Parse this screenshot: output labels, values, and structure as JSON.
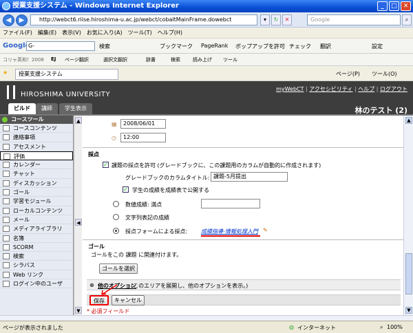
{
  "window": {
    "title": "授業支援システム - Windows Internet Explorer"
  },
  "address": {
    "url": "http://webct6.riise.hiroshima-u.ac.jp/webct/cobaltMainFrame.dowebct",
    "search_placeholder": "Google"
  },
  "menubar": [
    "ファイル(F)",
    "編集(E)",
    "表示(V)",
    "お気に入り(A)",
    "ツール(T)",
    "ヘルプ(H)"
  ],
  "google_toolbar": {
    "logo": "Google",
    "search": "G-",
    "items": [
      "検索",
      "ブックマーク",
      "PageRank",
      "ポップアップを許可",
      "チェック",
      "翻訳",
      "設定"
    ]
  },
  "dict_toolbar": {
    "items": [
      "コリャ英和！2008",
      "EJ",
      "ページ翻訳",
      "選択文翻訳",
      "辞書",
      "検索",
      "読み上げ",
      "ツール"
    ]
  },
  "ie_tab": {
    "label": "授業支援システム",
    "right_items": [
      "ページ(P)",
      "ツール(O)"
    ]
  },
  "header": {
    "university": "HIROSHIMA UNIVERSITY",
    "links": [
      "myWebCT",
      "アクセシビリティ",
      "ヘルプ",
      "ログアウト"
    ],
    "user": "林のテスト (2)",
    "tabs": {
      "build": "ビルド",
      "teacher": "講師",
      "student": "学生表示"
    }
  },
  "sidebar": {
    "heading": "コースツール",
    "items": [
      "コースコンテンツ",
      "連絡事項",
      "アセスメント",
      "評価",
      "カレンダー",
      "チャット",
      "ディスカッション",
      "ゴール",
      "学習モジュール",
      "ローカルコンテンツ",
      "メール",
      "メディアライブラリ",
      "名簿",
      "SCORM",
      "検索",
      "シラバス",
      "Web リンク",
      "ログイン中のユーザ"
    ]
  },
  "form": {
    "date_value": "2008/06/01",
    "time_value": "12:00",
    "grading_heading": "採点",
    "allow_grading_label": "課題の採点を許可 (グレードブックに、この課題用のカラムが自動的に作成されます)",
    "column_title_label": "グレードブックのカラムタイトル:",
    "column_title_value": "課題-5月提出",
    "publish_label": "学生の成績を成績表で公開する",
    "numeric_label": "数値成績: 満点",
    "letter_label": "文字列表記の成績",
    "form_label": "採点フォームによる採点:",
    "form_link": "成績指導-情報処理入門",
    "goal_heading": "ゴール",
    "goal_desc": "ゴールをこの 課題 に関連付けます。",
    "goal_button": "ゴールを選択",
    "other_options": "他のオプション",
    "other_options_desc": "(このエリアを展開し、他のオプションを表示。)",
    "save_button": "保存",
    "cancel_button": "キャンセル",
    "required_note": "* 必須フィールド"
  },
  "statusbar": {
    "left": "ページが表示されました",
    "zone": "インターネット",
    "zoom": "100%"
  }
}
